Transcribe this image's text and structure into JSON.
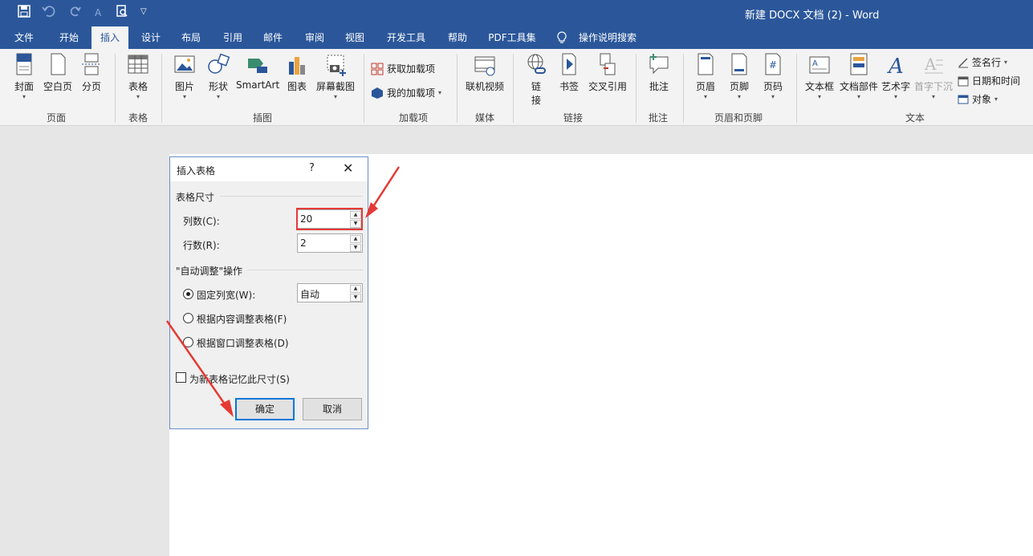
{
  "quick_access": {
    "save_icon": "save-icon",
    "undo_icon": "undo-icon",
    "redo_icon": "redo-icon",
    "font_icon_label": "A",
    "preview_icon": "print-preview-icon",
    "customize_icon": "customize-icon"
  },
  "title": "新建 DOCX 文档 (2)  -  Word",
  "tabs": [
    "文件",
    "开始",
    "插入",
    "设计",
    "布局",
    "引用",
    "邮件",
    "审阅",
    "视图",
    "开发工具",
    "帮助",
    "PDF工具集",
    "操作说明搜索"
  ],
  "active_tab": "插入",
  "ribbon": {
    "pages": {
      "cover": "封面",
      "blank": "空白页",
      "break": "分页",
      "group": "页面"
    },
    "tables": {
      "table": "表格",
      "group": "表格"
    },
    "illustrations": {
      "picture": "图片",
      "shapes": "形状",
      "smartart": "SmartArt",
      "chart": "图表",
      "screenshot": "屏幕截图",
      "group": "插图"
    },
    "addins": {
      "get": "获取加载项",
      "mine": "我的加载项",
      "group": "加载项"
    },
    "media": {
      "video": "联机视频",
      "group": "媒体"
    },
    "links": {
      "link_l1": "链",
      "link_l2": "接",
      "bookmark": "书签",
      "crossref": "交叉引用",
      "group": "链接"
    },
    "comments": {
      "comment": "批注",
      "group": "批注"
    },
    "header_footer": {
      "header": "页眉",
      "footer": "页脚",
      "pagenum": "页码",
      "group": "页眉和页脚"
    },
    "text": {
      "textbox": "文本框",
      "quickparts": "文档部件",
      "wordart": "艺术字",
      "dropcap": "首字下沉",
      "signature": "签名行",
      "datetime": "日期和时间",
      "object": "对象",
      "group": "文本"
    }
  },
  "dialog": {
    "title": "插入表格",
    "help": "?",
    "close": "✕",
    "size_section": "表格尺寸",
    "cols_label": "列数(C):",
    "cols_value": "20",
    "rows_label": "行数(R):",
    "rows_value": "2",
    "autofit_section": "\"自动调整\"操作",
    "fixed_label": "固定列宽(W):",
    "fixed_value": "自动",
    "content_label": "根据内容调整表格(F)",
    "window_label": "根据窗口调整表格(D)",
    "remember_label": "为新表格记忆此尺寸(S)",
    "ok": "确定",
    "cancel": "取消"
  },
  "colors": {
    "brand": "#2b579a",
    "annotation": "#e53935"
  }
}
